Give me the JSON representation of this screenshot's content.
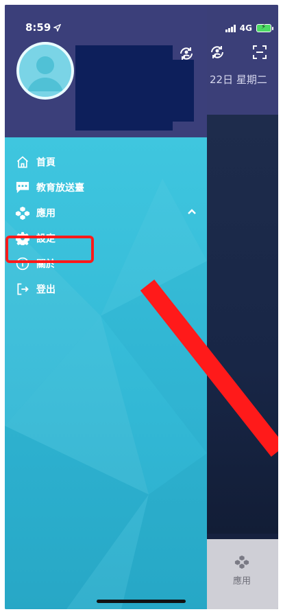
{
  "status": {
    "time": "8:59",
    "network": "4G"
  },
  "background_app": {
    "date_text": "22日 星期二",
    "tabbar_item_label": "應用"
  },
  "drawer": {
    "menu": [
      {
        "label": "首頁",
        "icon": "home-icon"
      },
      {
        "label": "教育放送臺",
        "icon": "chat-icon"
      },
      {
        "label": "應用",
        "icon": "apps-icon",
        "expanded": true
      },
      {
        "label": "設定",
        "icon": "gear-icon",
        "highlighted": true
      },
      {
        "label": "關於",
        "icon": "info-icon"
      },
      {
        "label": "登出",
        "icon": "logout-icon"
      }
    ]
  },
  "colors": {
    "drawer_header": "#3b3f7a",
    "drawer_body": "#33b9d6",
    "highlight": "#ff1a1a",
    "background_app": "#16213f"
  }
}
